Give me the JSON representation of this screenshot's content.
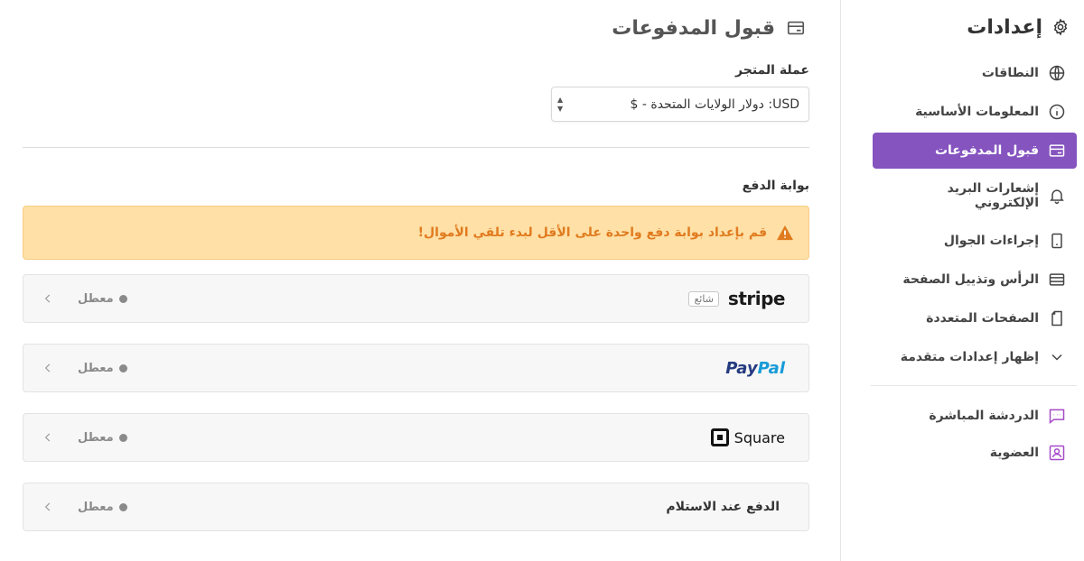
{
  "sidebar": {
    "title": "إعدادات",
    "title_icon": "gear-icon",
    "items": [
      {
        "label": "النطاقات",
        "icon": "globe-icon"
      },
      {
        "label": "المعلومات الأساسية",
        "icon": "info-icon"
      },
      {
        "label": "قبول المدفوعات",
        "icon": "payment-card-icon",
        "active": true
      },
      {
        "label": "إشعارات البريد الإلكتروني",
        "icon": "bell-icon"
      },
      {
        "label": "إجراءات الجوال",
        "icon": "mobile-icon"
      },
      {
        "label": "الرأس وتذييل الصفحة",
        "icon": "header-footer-icon"
      },
      {
        "label": "الصفحات المتعددة",
        "icon": "pages-icon"
      },
      {
        "label": "إظهار إعدادات متقدمة",
        "icon": "chevron-down-icon"
      }
    ],
    "extra_items": [
      {
        "label": "الدردشة المباشرة",
        "icon": "chat-icon"
      },
      {
        "label": "العضوية",
        "icon": "member-icon"
      }
    ]
  },
  "main": {
    "title": "قبول المدفوعات",
    "currency": {
      "label": "عملة المتجر",
      "value": "USD: دولار الولايات المتحدة - $"
    },
    "gateway_label": "بوابة الدفع",
    "alert": "قم بإعداد بوابة دفع واحدة على الأقل لبدء تلقي الأموال!",
    "gateways": [
      {
        "name": "stripe",
        "badge": "شائع",
        "status": "معطل"
      },
      {
        "name_pay": "Pay",
        "name_pal": "Pal",
        "status": "معطل"
      },
      {
        "name": "Square",
        "status": "معطل"
      },
      {
        "name": "الدفع عند الاستلام",
        "status": "معطل"
      }
    ]
  },
  "colors": {
    "accent": "#8554bf",
    "alert_bg": "#ffe0a6",
    "alert_text": "#e07b1f",
    "chat_icon": "#a64ac9"
  }
}
